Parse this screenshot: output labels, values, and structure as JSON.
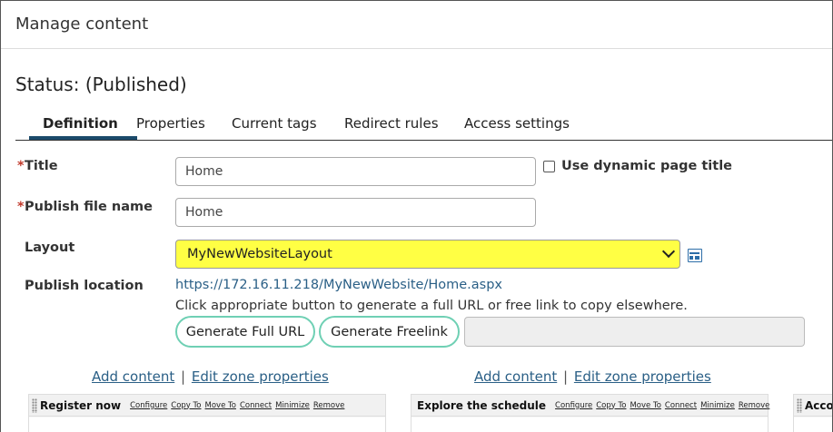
{
  "header": {
    "title": "Manage content"
  },
  "status": {
    "text": "Status: (Published)"
  },
  "tabs": [
    {
      "label": "Definition",
      "active": true
    },
    {
      "label": "Properties"
    },
    {
      "label": "Current tags"
    },
    {
      "label": "Redirect rules"
    },
    {
      "label": "Access settings"
    }
  ],
  "form": {
    "required_mark": "*",
    "title": {
      "label": "Title",
      "value": "Home"
    },
    "dynamic_title": {
      "label": "Use dynamic page title",
      "checked": false
    },
    "publish_file": {
      "label": "Publish file name",
      "value": "Home"
    },
    "layout": {
      "label": "Layout",
      "selected": "MyNewWebsiteLayout"
    },
    "publish_location": {
      "label": "Publish location",
      "url": "https://172.16.11.218/MyNewWebsite/Home.aspx",
      "hint": "Click appropriate button to generate a full URL or free link to copy elsewhere."
    },
    "buttons": {
      "full_url": "Generate Full URL",
      "freelink": "Generate Freelink"
    }
  },
  "zone_links": {
    "add_content": "Add content",
    "separator": "|",
    "edit_zone": "Edit zone properties"
  },
  "zones": [
    {
      "title": "Register now"
    },
    {
      "title": "Explore the schedule"
    },
    {
      "title": "Acco"
    }
  ],
  "zone_actions": [
    "Configure",
    "Copy To",
    "Move To",
    "Connect",
    "Minimize",
    "Remove"
  ],
  "colors": {
    "required": "#c0392b",
    "link": "#2a5f86",
    "layout_highlight": "#ffff44",
    "button_border": "#6fd0b4",
    "tab_active": "#1b4a6b"
  }
}
